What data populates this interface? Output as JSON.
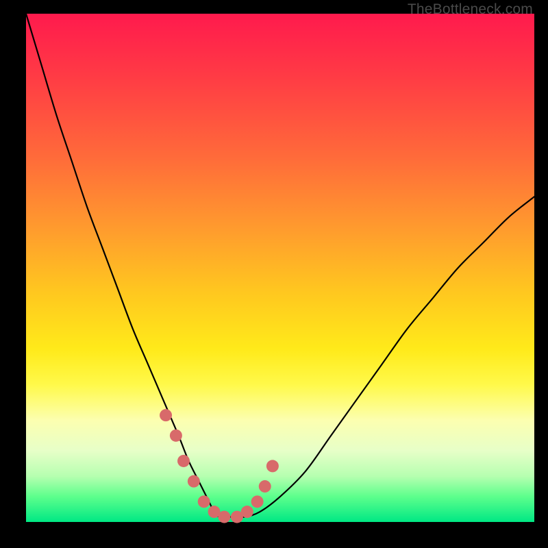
{
  "watermark": "TheBottleneck.com",
  "colors": {
    "background": "#000000",
    "gradient_top": "#ff1a4d",
    "gradient_bottom": "#00e884",
    "curve_stroke": "#000000",
    "marker_fill": "#d86a6a"
  },
  "chart_data": {
    "type": "line",
    "title": "",
    "xlabel": "",
    "ylabel": "",
    "xlim": [
      0,
      100
    ],
    "ylim": [
      0,
      100
    ],
    "x": [
      0,
      3,
      6,
      9,
      12,
      15,
      18,
      21,
      24,
      27,
      30,
      32,
      34,
      36,
      37,
      38,
      40,
      43,
      46,
      50,
      55,
      60,
      65,
      70,
      75,
      80,
      85,
      90,
      95,
      100
    ],
    "y": [
      100,
      90,
      80,
      71,
      62,
      54,
      46,
      38,
      31,
      24,
      17,
      12,
      8,
      4,
      2,
      1,
      1,
      1,
      2,
      5,
      10,
      17,
      24,
      31,
      38,
      44,
      50,
      55,
      60,
      64
    ],
    "markers": {
      "x": [
        27.5,
        29.5,
        31,
        33,
        35,
        37,
        39,
        41.5,
        43.5,
        45.5,
        47,
        48.5
      ],
      "y": [
        21,
        17,
        12,
        8,
        4,
        2,
        1,
        1,
        2,
        4,
        7,
        11
      ]
    }
  }
}
